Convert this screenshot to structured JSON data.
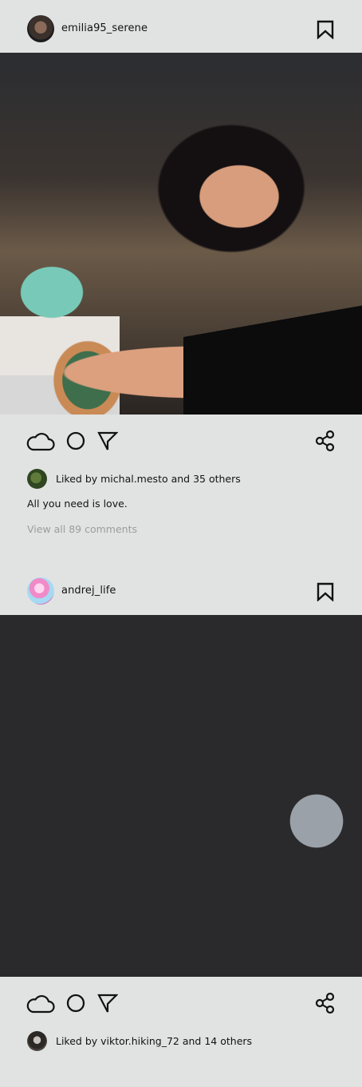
{
  "posts": [
    {
      "username": "emilia95_serene",
      "likes_text": "Liked by michal.mesto and 35 others",
      "caption": "All you need is love.",
      "view_comments": "View all 89 comments"
    },
    {
      "username": "andrej_life",
      "likes_text": "Liked by viktor.hiking_72 and 14 others"
    }
  ],
  "icons": {
    "bookmark": "bookmark-icon",
    "like": "cloud-like-icon",
    "comment": "circle-comment-icon",
    "send": "send-icon",
    "share": "share-icon"
  },
  "colors": {
    "background": "#e1e3e2",
    "text": "#121212",
    "muted_text": "#9b9d9c"
  }
}
